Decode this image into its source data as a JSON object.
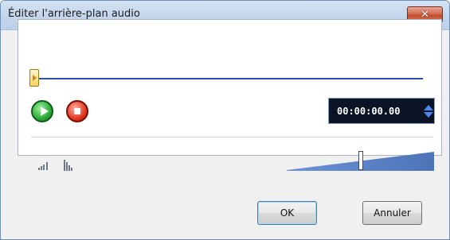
{
  "window": {
    "title": "Éditer l'arrière-plan audio",
    "close_icon": "close-x-icon"
  },
  "player": {
    "scrubber_position": 0,
    "play_icon": "play-icon",
    "stop_icon": "stop-icon",
    "timecode": "00:00:00.00",
    "spinner_icon": "up-down-spinner-icon"
  },
  "volume": {
    "low_icon": "volume-low-icon",
    "high_icon": "volume-high-icon",
    "level": 0.5
  },
  "buttons": {
    "ok_label": "OK",
    "cancel_label": "Annuler"
  },
  "colors": {
    "track": "#2b4cb4",
    "timecode_bg": "#0b1424",
    "ramp": "#5a82c8"
  }
}
